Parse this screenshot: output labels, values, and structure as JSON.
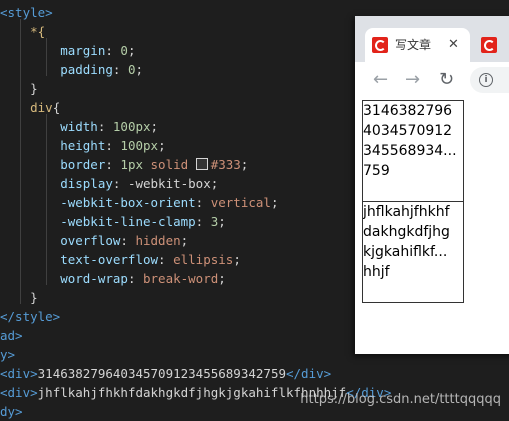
{
  "editor": {
    "lines": [
      [
        {
          "c": "tag",
          "t": "<style>"
        }
      ],
      [
        {
          "c": "sel",
          "t": "    *{"
        }
      ],
      [
        {
          "c": "prop",
          "t": "        margin"
        },
        {
          "c": "plain",
          "t": ": "
        },
        {
          "c": "num",
          "t": "0"
        },
        {
          "c": "plain",
          "t": ";"
        }
      ],
      [
        {
          "c": "prop",
          "t": "        padding"
        },
        {
          "c": "plain",
          "t": ": "
        },
        {
          "c": "num",
          "t": "0"
        },
        {
          "c": "plain",
          "t": ";"
        }
      ],
      [
        {
          "c": "plain",
          "t": "    }"
        }
      ],
      [
        {
          "c": "sel",
          "t": "    div"
        },
        {
          "c": "plain",
          "t": "{"
        }
      ],
      [
        {
          "c": "prop",
          "t": "        width"
        },
        {
          "c": "plain",
          "t": ": "
        },
        {
          "c": "num",
          "t": "100px"
        },
        {
          "c": "plain",
          "t": ";"
        }
      ],
      [
        {
          "c": "prop",
          "t": "        height"
        },
        {
          "c": "plain",
          "t": ": "
        },
        {
          "c": "num",
          "t": "100px"
        },
        {
          "c": "plain",
          "t": ";"
        }
      ],
      [
        {
          "c": "prop",
          "t": "        border"
        },
        {
          "c": "plain",
          "t": ": "
        },
        {
          "c": "num",
          "t": "1px "
        },
        {
          "c": "str",
          "t": "solid "
        },
        {
          "c": "swatch",
          "t": ""
        },
        {
          "c": "str",
          "t": "#333"
        },
        {
          "c": "plain",
          "t": ";"
        }
      ],
      [
        {
          "c": "prop",
          "t": "        display"
        },
        {
          "c": "plain",
          "t": ": "
        },
        {
          "c": "plain",
          "t": "-webkit-box"
        },
        {
          "c": "plain",
          "t": ";"
        }
      ],
      [
        {
          "c": "prop",
          "t": "        -webkit-box-orient"
        },
        {
          "c": "plain",
          "t": ": "
        },
        {
          "c": "str",
          "t": "vertical"
        },
        {
          "c": "plain",
          "t": ";"
        }
      ],
      [
        {
          "c": "prop",
          "t": "        -webkit-line-clamp"
        },
        {
          "c": "plain",
          "t": ": "
        },
        {
          "c": "num",
          "t": "3"
        },
        {
          "c": "plain",
          "t": ";"
        }
      ],
      [
        {
          "c": "prop",
          "t": "        overflow"
        },
        {
          "c": "plain",
          "t": ": "
        },
        {
          "c": "str",
          "t": "hidden"
        },
        {
          "c": "plain",
          "t": ";"
        }
      ],
      [
        {
          "c": "prop",
          "t": "        text-overflow"
        },
        {
          "c": "plain",
          "t": ": "
        },
        {
          "c": "str",
          "t": "ellipsis"
        },
        {
          "c": "plain",
          "t": ";"
        }
      ],
      [
        {
          "c": "prop",
          "t": "        word-wrap"
        },
        {
          "c": "plain",
          "t": ": "
        },
        {
          "c": "str",
          "t": "break-word"
        },
        {
          "c": "plain",
          "t": ";"
        }
      ],
      [
        {
          "c": "plain",
          "t": "    }"
        }
      ],
      [
        {
          "c": "tag",
          "t": "</style>"
        }
      ],
      [
        {
          "c": "tag",
          "t": "ad>"
        }
      ],
      [
        {
          "c": "tag",
          "t": "y>"
        }
      ],
      [
        {
          "c": "tag",
          "t": "<div>"
        },
        {
          "c": "plain",
          "t": "3146382796403457091234556893427"
        },
        {
          "c": "plain",
          "t": "59"
        },
        {
          "c": "tag",
          "t": "</div>"
        }
      ],
      [
        {
          "c": "tag",
          "t": "<div>"
        },
        {
          "c": "plain",
          "t": "jhflkahjfhkhfdakhgkdfjhgkjgkahiflkfhnhhjf"
        },
        {
          "c": "tag",
          "t": "</div>"
        }
      ],
      [
        {
          "c": "tag",
          "t": "dy>"
        }
      ]
    ]
  },
  "browser": {
    "tab_title": "写文章",
    "tab_close": "✕",
    "nav_back": "←",
    "nav_forward": "→",
    "nav_reload": "↻",
    "info": "i"
  },
  "demo": {
    "box1_lines": [
      "3146382796",
      "4034570912",
      "345568934...",
      "759"
    ],
    "box2_lines": [
      "jhflkahjfhkhf",
      "dakhgkdfjhg",
      "kjgkahiflkf...",
      "hhjf"
    ]
  },
  "watermark": "https://blog.csdn.net/ttttqqqqq",
  "colors": {
    "editor_bg": "#1e1e1e",
    "tag": "#569cd6",
    "selector": "#d7ba7d",
    "property": "#9cdcfe",
    "number": "#b5cea8",
    "string": "#ce9178",
    "favicon": "#e2231a"
  }
}
